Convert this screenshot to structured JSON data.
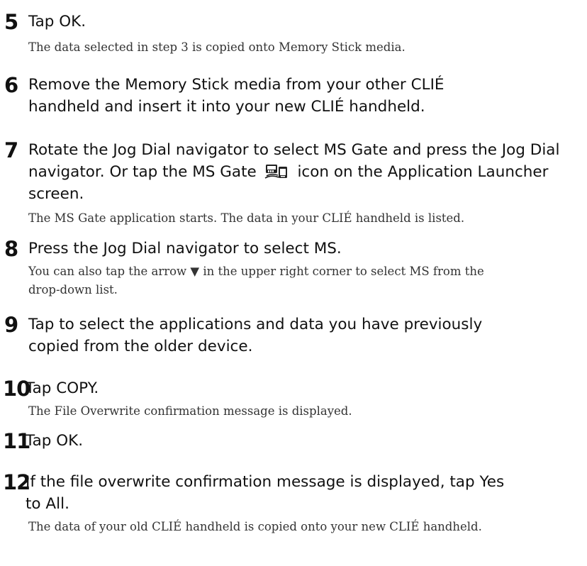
{
  "steps": [
    {
      "number": "5",
      "title": "Tap OK.",
      "body": "The data selected in step 3 is copied onto Memory Stick media."
    },
    {
      "number": "6",
      "title": "Remove the Memory Stick media from your other CLIÉ handheld and insert it into your new CLIÉ handheld."
    },
    {
      "number": "7",
      "title_before_icon": "Rotate the Jog Dial navigator to select MS Gate and press the Jog Dial navigator. Or tap the MS Gate",
      "title_after_icon": "icon on the Application Launcher screen.",
      "icon": "ms-gate-icon",
      "body": "The MS Gate application starts. The data in your CLIÉ handheld is listed."
    },
    {
      "number": "8",
      "title": "Press the Jog Dial navigator to select MS.",
      "body": "You can also tap the arrow ▼ in the upper right corner to select MS from the drop-down list."
    },
    {
      "number": "9",
      "title": "Tap to select the applications and data you have previously copied from the older device."
    },
    {
      "number": "10",
      "title": "Tap COPY.",
      "body": "The File Overwrite confirmation message is displayed."
    },
    {
      "number": "11",
      "title": "Tap OK."
    },
    {
      "number": "12",
      "title": "If the file overwrite confirmation message is displayed, tap Yes to All.",
      "body": "The data of your old CLIÉ handheld is copied onto your new CLIÉ handheld."
    }
  ]
}
